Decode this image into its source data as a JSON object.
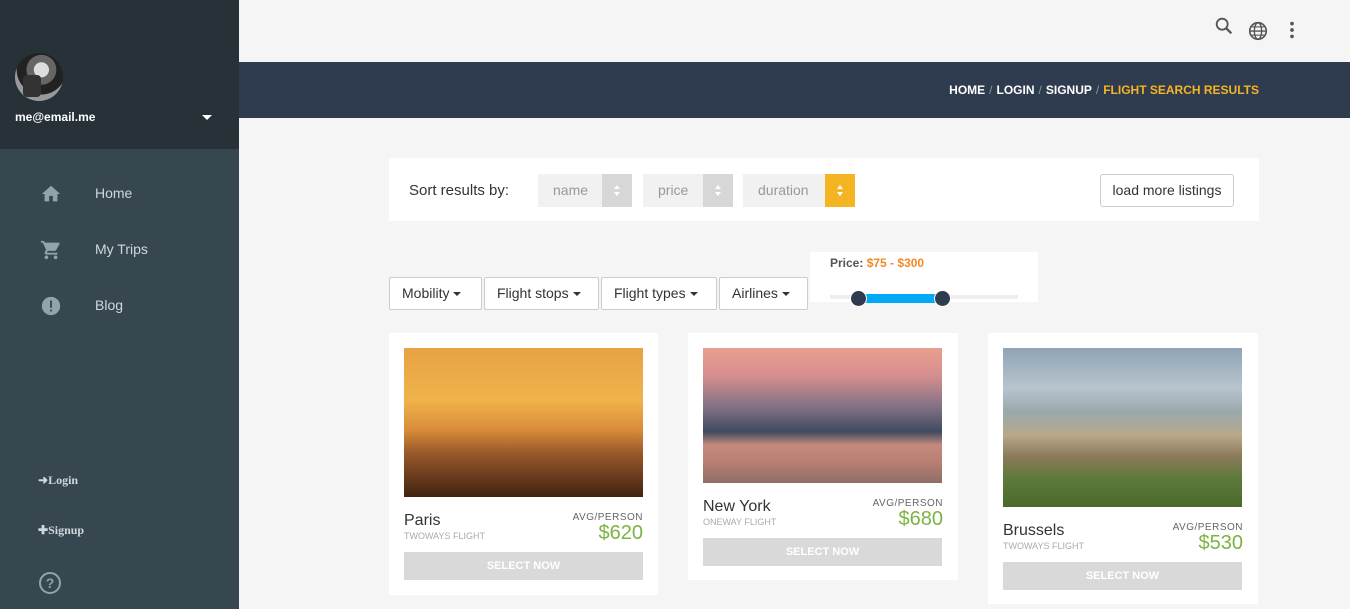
{
  "sidebar": {
    "email": "me@email.me",
    "nav": [
      {
        "label": "Home",
        "icon": "home-icon"
      },
      {
        "label": "My Trips",
        "icon": "cart-icon"
      },
      {
        "label": "Blog",
        "icon": "alert-circle-icon"
      }
    ],
    "login_label": "Login",
    "signup_label": "Signup",
    "help_glyph": "?"
  },
  "topbar": {
    "icons": [
      "search-icon",
      "globe-icon",
      "more-vert-icon"
    ]
  },
  "breadcrumb": {
    "items": [
      "HOME",
      "LOGIN",
      "SIGNUP"
    ],
    "active": "FLIGHT SEARCH RESULTS",
    "separator": "/"
  },
  "sort": {
    "label": "Sort results by:",
    "options": [
      "name",
      "price",
      "duration"
    ],
    "load_more": "load more listings"
  },
  "filters": {
    "buttons": [
      "Mobility",
      "Flight stops",
      "Flight types",
      "Airlines"
    ],
    "price_label": "Price:",
    "price_range": "$75 - $300"
  },
  "results": [
    {
      "city": "Paris",
      "type": "TWOWAYS FLIGHT",
      "avg_label": "AVG/PERSON",
      "price": "$620",
      "button": "SELECT NOW"
    },
    {
      "city": "New York",
      "type": "ONEWAY FLIGHT",
      "avg_label": "AVG/PERSON",
      "price": "$680",
      "button": "SELECT NOW"
    },
    {
      "city": "Brussels",
      "type": "TWOWAYS FLIGHT",
      "avg_label": "AVG/PERSON",
      "price": "$530",
      "button": "SELECT NOW"
    }
  ],
  "colors": {
    "sidebar": "#37474f",
    "profile": "#263238",
    "header": "#2f3c50",
    "accent": "#f5b522",
    "price_green": "#7cb342",
    "slider": "#03a9f4"
  }
}
